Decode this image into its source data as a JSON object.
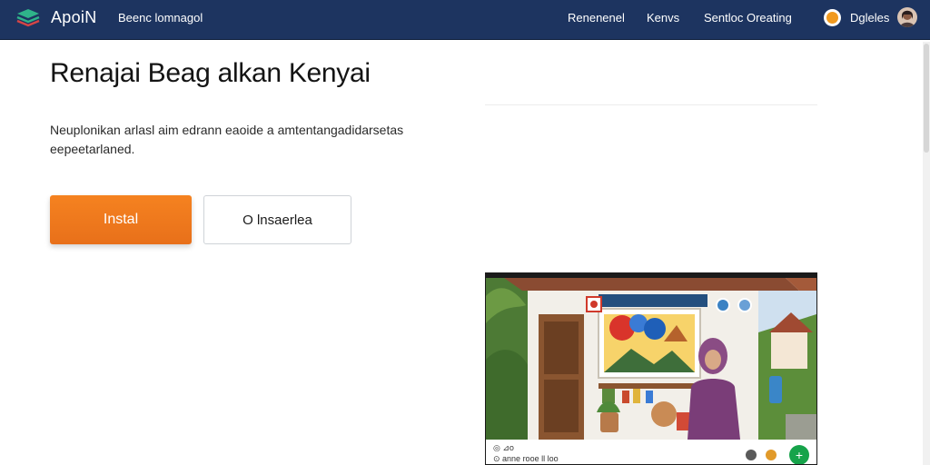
{
  "header": {
    "brand": "ApoiN",
    "subtitle": "Beenc lomnagol",
    "nav": [
      "Renenenel",
      "Kenvs",
      "Sentloc Oreating"
    ],
    "user_name": "Dgleles",
    "brand_color": "#1d3460"
  },
  "hero": {
    "title": "Renajai Beag alkan Kenyai",
    "description": "Neuplonikan arlasl aim edrann eaoide a amtentangadidarsetas eepeetarlaned.",
    "install_label": "Instal",
    "secondary_label": "O lnsaerlea",
    "accent_color": "#f58220"
  },
  "preview_card": {
    "caption_top": "◎ ⊿o",
    "caption_bottom": "⊙ anne rooe ll loo",
    "add_icon": "+"
  },
  "icons": [
    "logo-icon",
    "notification-icon",
    "user-avatar",
    "camera-icon",
    "info-icon",
    "add-icon"
  ]
}
